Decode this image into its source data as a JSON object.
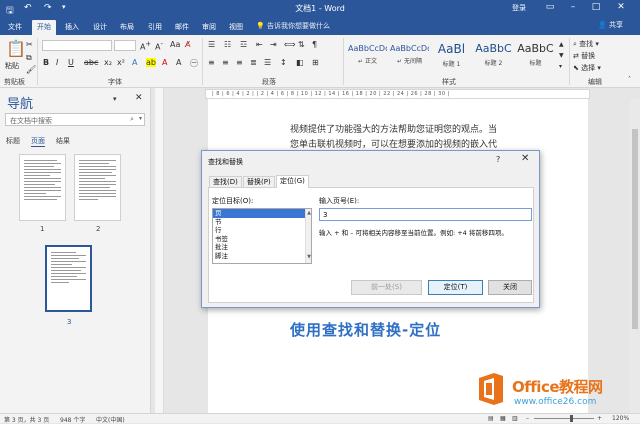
{
  "window": {
    "title": "文档1 - Word",
    "login": "登录",
    "share": "共享",
    "quick_access": [
      "save-icon",
      "undo-icon",
      "redo-icon"
    ],
    "controls": [
      "ribbon-display-icon",
      "minimize-icon",
      "maximize-icon",
      "close-icon"
    ]
  },
  "tabs": [
    "文件",
    "开始",
    "插入",
    "设计",
    "布局",
    "引用",
    "邮件",
    "审阅",
    "视图"
  ],
  "active_tab": "开始",
  "tell_me": "告诉我你想要做什么",
  "ribbon": {
    "groups": {
      "clipboard": "剪贴板",
      "font": "字体",
      "paragraph": "段落",
      "styles": "样式",
      "editing": "编辑"
    },
    "paste_label": "粘贴",
    "font_name": "",
    "font_size": "",
    "styles": [
      {
        "preview": "AaBbCcDd",
        "name": "↵ 正文"
      },
      {
        "preview": "AaBbCcDd",
        "name": "↵ 无间隔"
      },
      {
        "preview": "AaBl",
        "name": "标题 1"
      },
      {
        "preview": "AaBbC",
        "name": "标题 2"
      },
      {
        "preview": "AaBbC",
        "name": "标题"
      }
    ],
    "editing": {
      "find": "查找",
      "replace": "替换",
      "select": "选择"
    }
  },
  "nav_pane": {
    "title": "导航",
    "search_placeholder": "在文档中搜索",
    "tabs": [
      "标题",
      "页面",
      "结果"
    ],
    "active_tab": "页面",
    "thumbnails": [
      "1",
      "2",
      "3"
    ]
  },
  "ruler_text": "| 8 | 6 | 4 | 2 | | 2 | 4 | 6 | 8 | 10 | 12 | 14 | 16 | 18 | 20 | 22 | 24 | 26 | 28 | 30 |",
  "document": {
    "lines": [
      "视频提供了功能强大的方法帮助您证明您的观点。当",
      "您单击联机视频时，可以在想要添加的视频的嵌入代"
    ],
    "headline": "使用查找和替换-定位"
  },
  "dialog": {
    "title": "查找和替换",
    "help": "?",
    "close": "✕",
    "tabs": [
      "查找(D)",
      "替换(P)",
      "定位(G)"
    ],
    "active_tab": "定位(G)",
    "goto_label": "定位目标(O):",
    "goto_items": [
      "页",
      "节",
      "行",
      "书签",
      "批注",
      "脚注"
    ],
    "selected_item": "页",
    "page_label": "输入页号(E):",
    "page_value": "3",
    "hint": "输入 + 和 – 可将相关内容移至当前位置。例如: +4 将前移四项。",
    "buttons": {
      "previous": "前一处(S)",
      "goto": "定位(T)",
      "close": "关闭"
    }
  },
  "status": {
    "page": "第 3 页，共 3 页",
    "words": "948 个字",
    "language": "中文(中国)",
    "zoom": "120%"
  },
  "watermark": {
    "line1": "Office教程网",
    "line2": "www.office26.com"
  },
  "colors": {
    "brand": "#2b579a",
    "headline": "#2f6fc4",
    "watermark_orange": "#e8731a",
    "watermark_blue": "#3fa1d8",
    "selection": "#3a76d4"
  }
}
